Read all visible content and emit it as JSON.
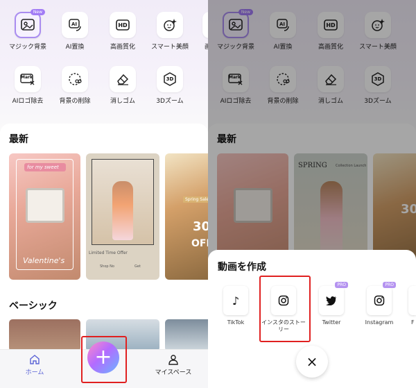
{
  "tools_row1": [
    {
      "label": "マジック背景",
      "icon": "magic-background-icon",
      "badge": "New"
    },
    {
      "label": "AI置換",
      "icon": "ai-replace-icon"
    },
    {
      "label": "高画質化",
      "icon": "hd-icon",
      "glyph": "HD"
    },
    {
      "label": "スマート美顔",
      "icon": "smart-beauty-icon"
    },
    {
      "label": "画",
      "icon": "partial-tool-icon"
    }
  ],
  "tools_row2": [
    {
      "label": "AIロゴ除去",
      "icon": "ai-logo-remove-icon",
      "glyph": "Mark"
    },
    {
      "label": "背景の削除",
      "icon": "background-remove-icon"
    },
    {
      "label": "消しゴム",
      "icon": "eraser-icon"
    },
    {
      "label": "3Dズーム",
      "icon": "3d-zoom-icon",
      "glyph": "3D"
    }
  ],
  "sections": {
    "latest": "最新",
    "basic": "ベーシック"
  },
  "template_texts": {
    "card1_banner": "for my sweet",
    "card1_script": "Valentine's",
    "card2_offer": "Limited Time Offer",
    "card2_shop": "Shop No",
    "card2_get": "Get",
    "card3_sale": "Spring Sale",
    "card3_percent": "30",
    "card3_off": "OFF",
    "card2_spring": "SPRING",
    "card2_spring_sub": "Collection Launch"
  },
  "tabbar": {
    "home": "ホーム",
    "plus": "+",
    "my": "マイスペース"
  },
  "sheet": {
    "title": "動画を作成",
    "options": [
      {
        "label": "TikTok",
        "icon": "tiktok-icon",
        "glyph": "♪"
      },
      {
        "label": "インスタのストーリー",
        "icon": "instagram-story-icon"
      },
      {
        "label": "Twitter",
        "icon": "twitter-icon",
        "badge": "PRO"
      },
      {
        "label": "Instagram",
        "icon": "instagram-icon",
        "badge": "PRO"
      },
      {
        "label": "F",
        "icon": "facebook-icon"
      }
    ],
    "close": "×"
  },
  "colors": {
    "accent": "#a27cf5",
    "highlight": "#e02020",
    "home_tab": "#5a63d6"
  }
}
